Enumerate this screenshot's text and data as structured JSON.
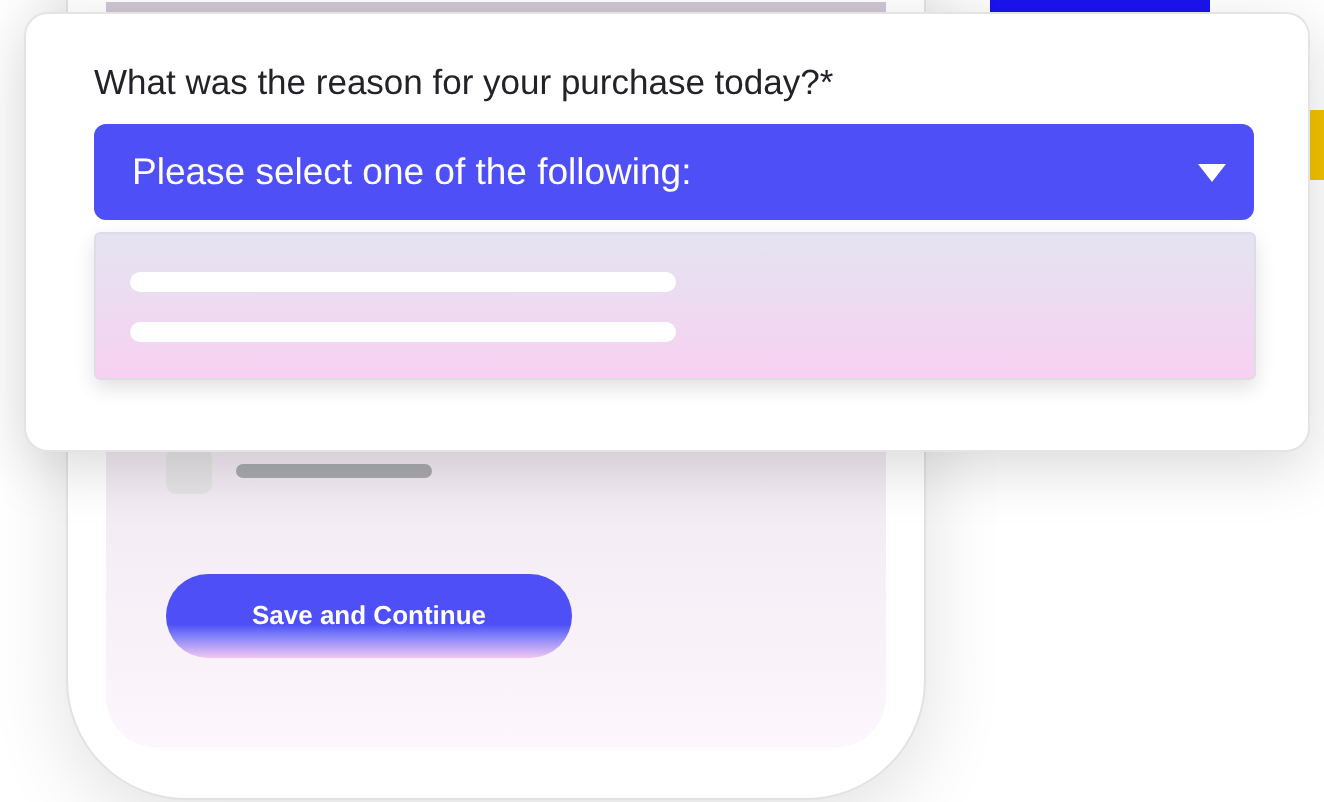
{
  "question": {
    "label": "What was the reason for your purchase today?*",
    "select": {
      "placeholder": "Please select one of the following:",
      "expanded": true
    }
  },
  "form": {
    "checkbox": {
      "checked": false
    },
    "button": "Save and Continue"
  }
}
